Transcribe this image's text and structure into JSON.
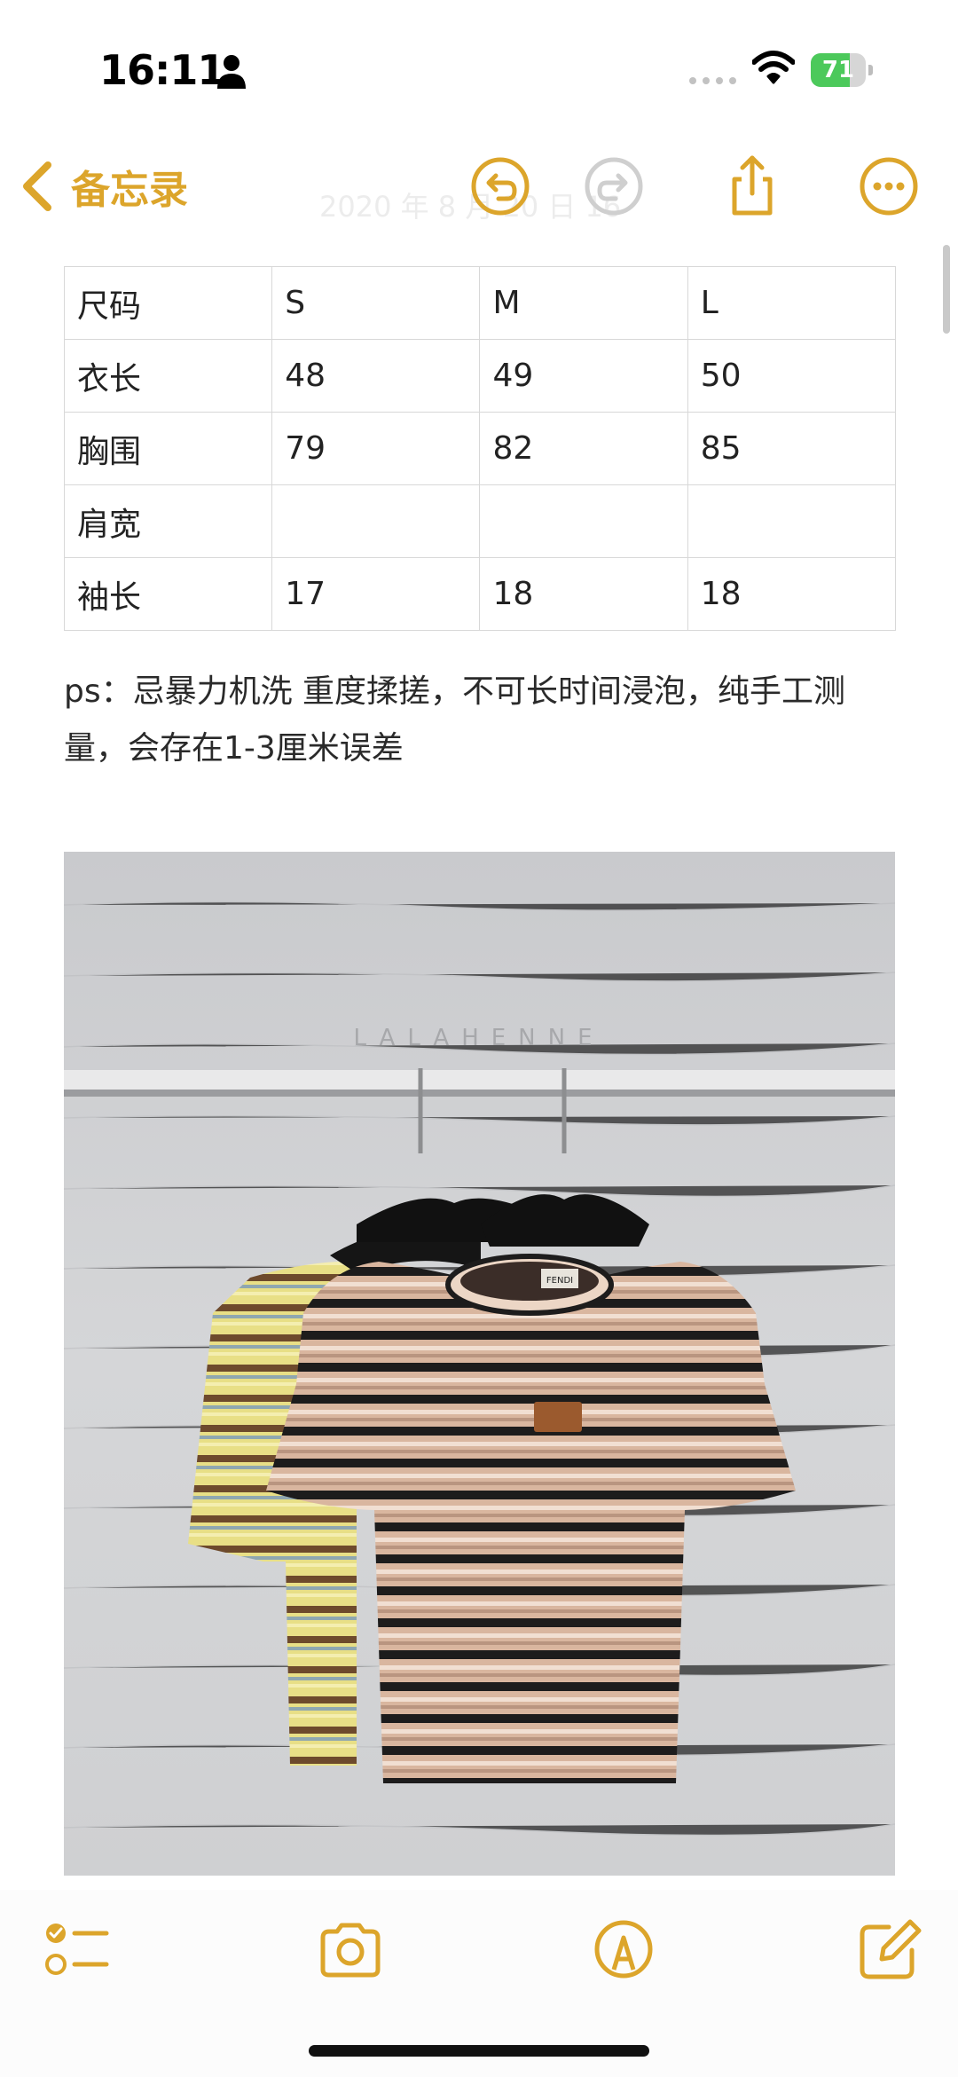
{
  "status": {
    "time": "16:11",
    "battery": "71",
    "battery_level": 0.71
  },
  "nav": {
    "back_label": "备忘录",
    "date": "2020 年 8 月 20 日 16",
    "accent": "#dca52b"
  },
  "table": {
    "rows": [
      [
        "尺码",
        "S",
        "M",
        "L"
      ],
      [
        "衣长",
        "48",
        "49",
        "50"
      ],
      [
        "胸围",
        "79",
        "82",
        "85"
      ],
      [
        "肩宽",
        "",
        "",
        ""
      ],
      [
        "袖长",
        "17",
        "18",
        "18"
      ]
    ]
  },
  "note": {
    "text": "ps：忌暴力机洗 重度揉搓，不可长时间浸泡，纯手工测量，会存在1-3厘米误差"
  },
  "photo": {
    "watermark": "LALAHENNE",
    "label": "FENDI"
  },
  "toolbar": {
    "icons": [
      "checklist-icon",
      "camera-icon",
      "markup-icon",
      "compose-icon"
    ]
  }
}
